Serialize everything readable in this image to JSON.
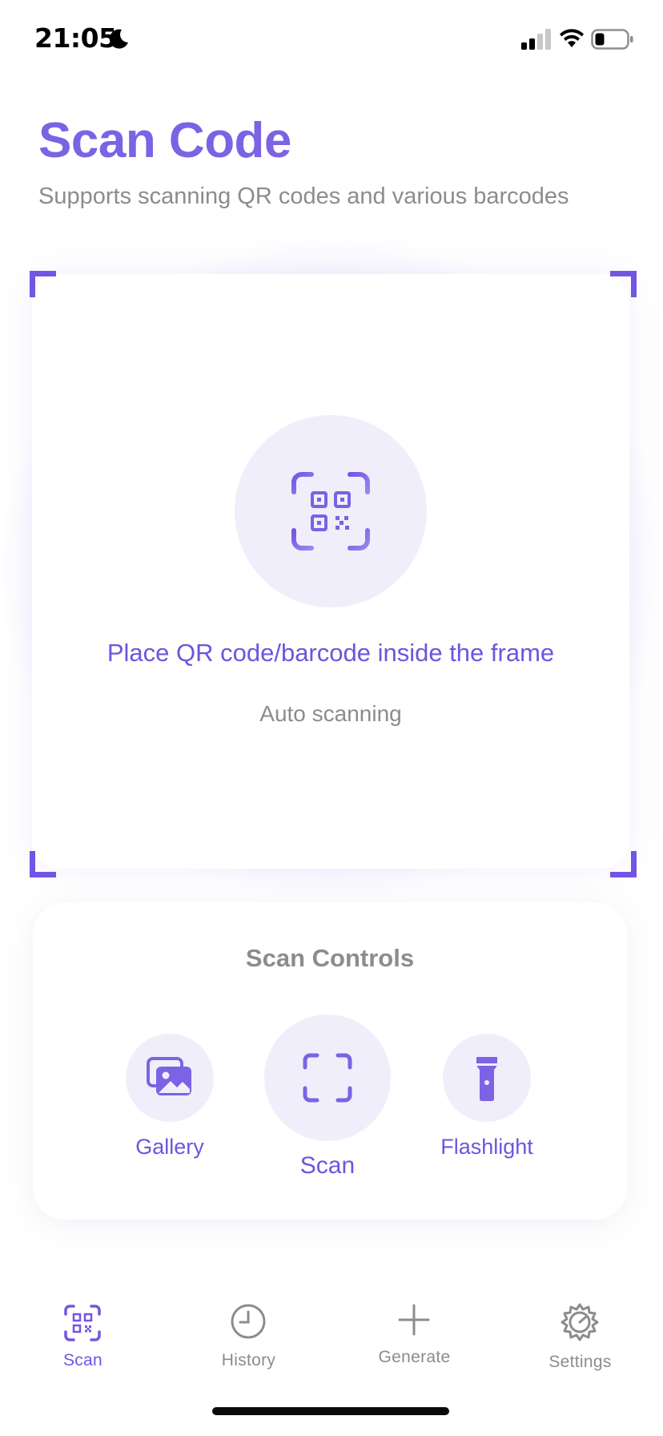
{
  "status_bar": {
    "time": "21:05",
    "icons": [
      "moon-icon",
      "signal-icon",
      "wifi-icon",
      "battery-icon"
    ]
  },
  "header": {
    "title": "Scan Code",
    "subtitle": "Supports scanning QR codes and various barcodes"
  },
  "scanner": {
    "icon": "qr-code-icon",
    "hint": "Place QR code/barcode inside the frame",
    "status": "Auto scanning"
  },
  "controls": {
    "title": "Scan Controls",
    "gallery_label": "Gallery",
    "scan_label": "Scan",
    "flashlight_label": "Flashlight"
  },
  "tabs": [
    {
      "label": "Scan",
      "icon": "qr-code-icon",
      "active": true
    },
    {
      "label": "History",
      "icon": "clock-icon",
      "active": false
    },
    {
      "label": "Generate",
      "icon": "plus-icon",
      "active": false
    },
    {
      "label": "Settings",
      "icon": "gear-icon",
      "active": false
    }
  ],
  "colors": {
    "accent": "#7b63e4",
    "accent_dark": "#6e55dc",
    "muted_text": "#8c8c8f",
    "soft_fill": "#f1eefc"
  }
}
